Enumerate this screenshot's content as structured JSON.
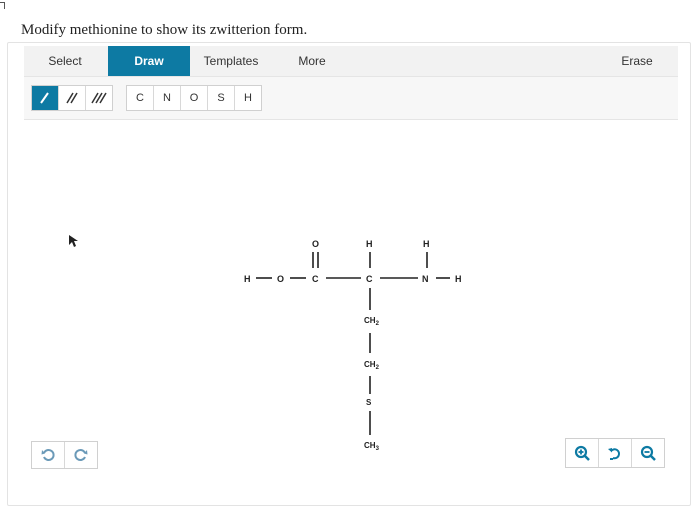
{
  "question": "Modify methionine to show its zwitterion form.",
  "toolbar": {
    "select_label": "Select",
    "draw_label": "Draw",
    "templates_label": "Templates",
    "more_label": "More",
    "erase_label": "Erase",
    "active_tab": "Draw"
  },
  "bond_tools": [
    {
      "name": "single-bond",
      "label": "/"
    },
    {
      "name": "double-bond",
      "label": "//"
    },
    {
      "name": "triple-bond",
      "label": "///"
    }
  ],
  "atom_tools": [
    "C",
    "N",
    "O",
    "S",
    "H"
  ],
  "molecule": {
    "atoms": {
      "h_left": "H",
      "o_single": "O",
      "c_carbonyl": "C",
      "o_double": "O",
      "c_alpha": "C",
      "h_alpha": "H",
      "n": "N",
      "h_n_top": "H",
      "h_n_right": "H",
      "ch2_1": "CH",
      "ch2_1_sub": "2",
      "ch2_2": "CH",
      "ch2_2_sub": "2",
      "s": "S",
      "ch3": "CH",
      "ch3_sub": "3"
    }
  },
  "colors": {
    "accent": "#0d7aa3",
    "toolbar_bg": "#f2f2f2",
    "zoom_icon": "#0d7aa3",
    "undo_icon": "#6b9ab8"
  },
  "icons": {
    "undo": "undo-icon",
    "redo": "redo-icon",
    "zoom_in": "zoom-in-icon",
    "zoom_reset": "zoom-reset-icon",
    "zoom_out": "zoom-out-icon",
    "cursor": "arrow-cursor-icon"
  }
}
